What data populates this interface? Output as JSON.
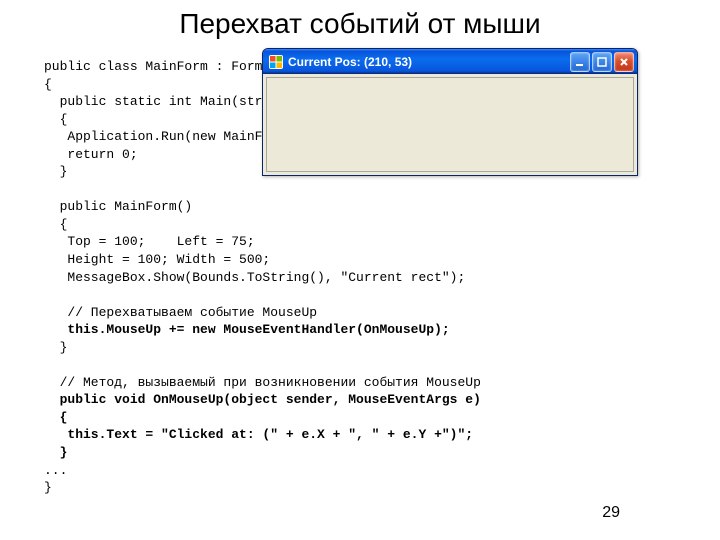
{
  "title": "Перехват событий от мыши",
  "page_number": "29",
  "code": {
    "l1": "public class MainForm : Form",
    "l2": "{",
    "l3": "  public static int Main(string[] args)",
    "l4": "  {",
    "l5": "   Application.Run(new MainForm());",
    "l6": "   return 0;",
    "l7": "  }",
    "l8": "",
    "l9": "  public MainForm()",
    "l10": "  {",
    "l11": "   Top = 100;    Left = 75;",
    "l12": "   Height = 100; Width = 500;",
    "l13": "   MessageBox.Show(Bounds.ToString(), \"Current rect\");",
    "l14": "",
    "l15": "   // Перехватываем событие MouseUp",
    "l16b": "   this.MouseUp += new MouseEventHandler(OnMouseUp);",
    "l17": "  }",
    "l18": "",
    "l19": "  // Метод, вызываемый при возникновении события MouseUp",
    "l20b": "  public void OnMouseUp(object sender, MouseEventArgs e)",
    "l21b": "  {",
    "l22b": "   this.Text = \"Clicked at: (\" + e.X + \", \" + e.Y +\")\";",
    "l23b": "  }",
    "l24": "...",
    "l25": "}"
  },
  "window": {
    "title": "Current Pos: (210, 53)",
    "buttons": {
      "minimize": "minimize",
      "maximize": "maximize",
      "close": "close"
    }
  }
}
